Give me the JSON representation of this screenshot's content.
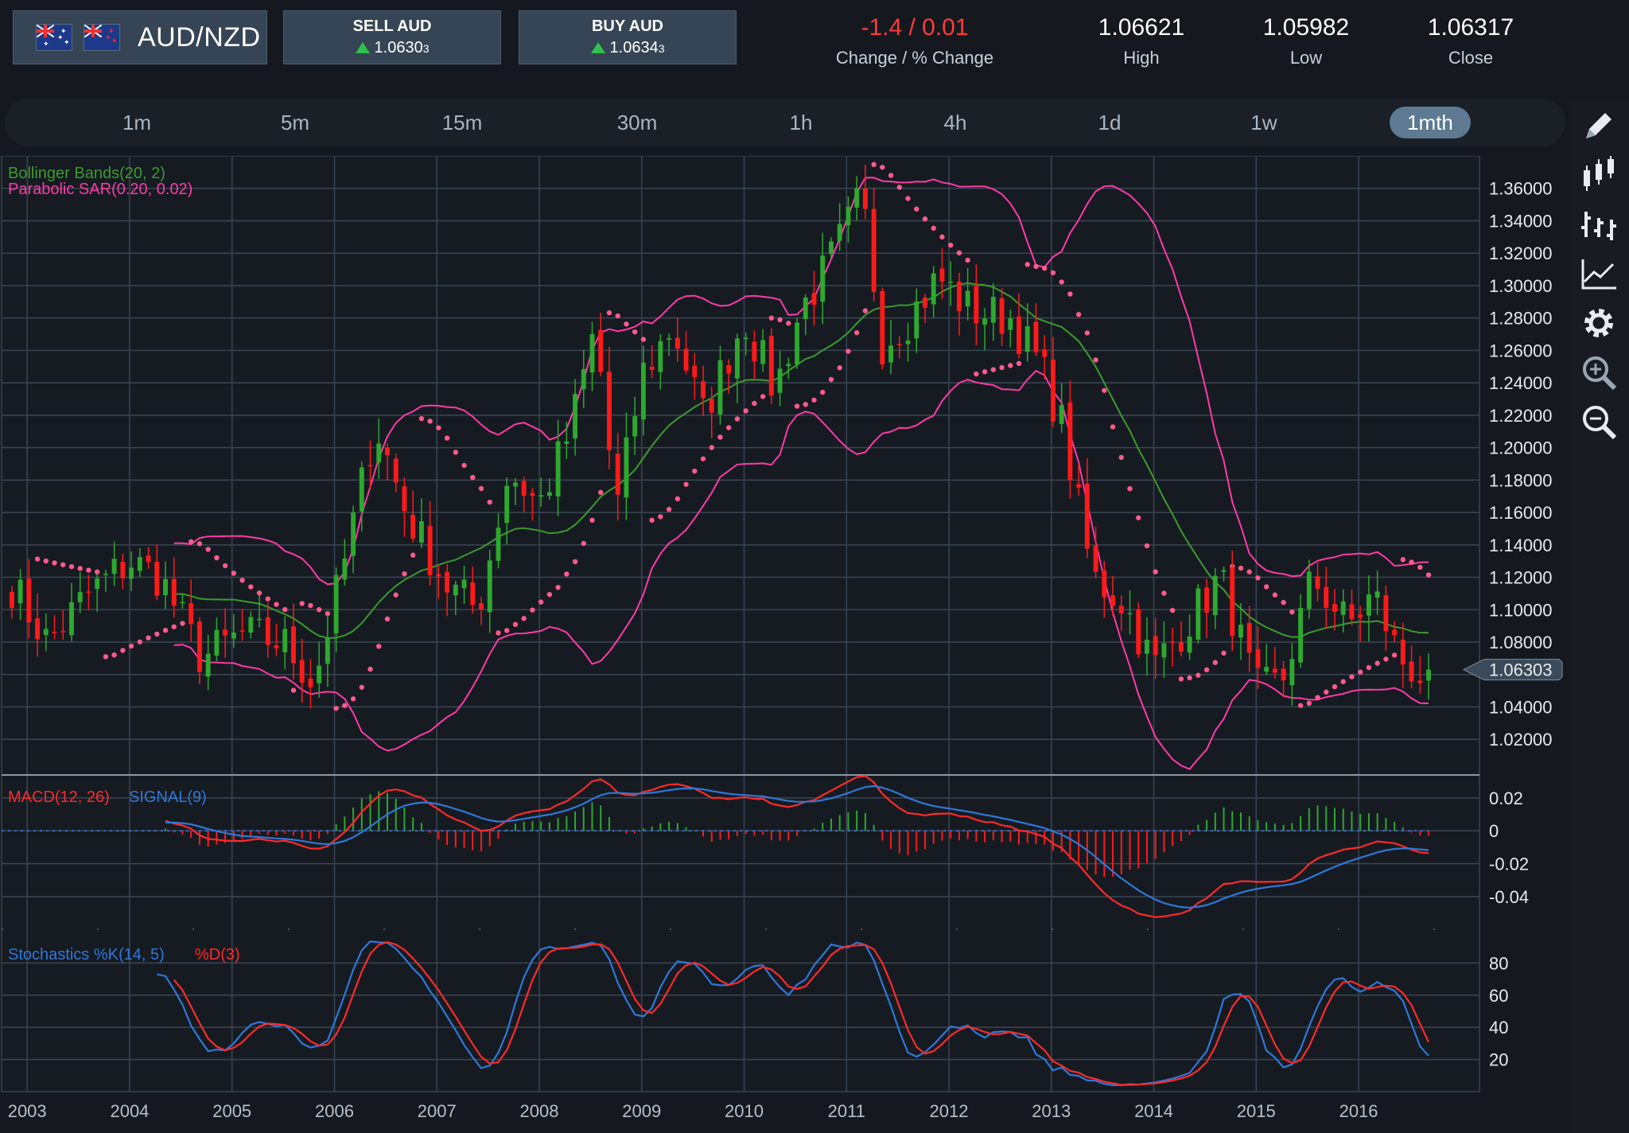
{
  "header": {
    "pair": "AUD/NZD",
    "sell": {
      "label": "SELL AUD",
      "price": "1.0630",
      "pip": "3"
    },
    "buy": {
      "label": "BUY AUD",
      "price": "1.0634",
      "pip": "3"
    },
    "change": {
      "value": "-1.4 / 0.01",
      "label": "Change / % Change"
    },
    "high": {
      "value": "1.06621",
      "label": "High"
    },
    "low": {
      "value": "1.05982",
      "label": "Low"
    },
    "close": {
      "value": "1.06317",
      "label": "Close"
    }
  },
  "timeframes": [
    "1m",
    "5m",
    "15m",
    "30m",
    "1h",
    "4h",
    "1d",
    "1w",
    "1mth"
  ],
  "active_timeframe": "1mth",
  "tools": [
    "pencil-icon",
    "candlestick-icon",
    "bar-chart-icon",
    "line-chart-icon",
    "gear-icon",
    "zoom-in-icon",
    "zoom-out-icon"
  ],
  "colors": {
    "bull": "#2ea82e",
    "bear": "#ff1a1a",
    "bollinger_mid": "#3c9a2e",
    "bollinger_bands": "#ff3aa8",
    "sar": "#ff5a8c",
    "macd": "#ff2a2a",
    "signal": "#2f78d8",
    "stoch_k": "#2f78d8",
    "stoch_d": "#ff2a2a"
  },
  "chart_data": {
    "type": "candlestick",
    "x_labels": [
      "2003",
      "2004",
      "2005",
      "2006",
      "2007",
      "2008",
      "2009",
      "2010",
      "2011",
      "2012",
      "2013",
      "2014",
      "2015",
      "2016"
    ],
    "price_axis": {
      "ticks": [
        "1.36000",
        "1.34000",
        "1.32000",
        "1.30000",
        "1.28000",
        "1.26000",
        "1.24000",
        "1.22000",
        "1.20000",
        "1.18000",
        "1.16000",
        "1.14000",
        "1.12000",
        "1.10000",
        "1.08000",
        "1.04000",
        "1.02000"
      ],
      "current": "1.06303",
      "current_value": 1.06303,
      "range": [
        0.999,
        1.38
      ]
    },
    "price_anchors": [
      [
        2002.85,
        1.115
      ],
      [
        2003.2,
        1.08
      ],
      [
        2003.6,
        1.11
      ],
      [
        2004.0,
        1.13
      ],
      [
        2004.3,
        1.12
      ],
      [
        2004.7,
        1.07
      ],
      [
        2005.1,
        1.085
      ],
      [
        2005.5,
        1.08
      ],
      [
        2005.8,
        1.055
      ],
      [
        2006.1,
        1.13
      ],
      [
        2006.4,
        1.215
      ],
      [
        2006.7,
        1.16
      ],
      [
        2007.1,
        1.115
      ],
      [
        2007.4,
        1.1
      ],
      [
        2007.7,
        1.185
      ],
      [
        2008.0,
        1.165
      ],
      [
        2008.3,
        1.21
      ],
      [
        2008.55,
        1.275
      ],
      [
        2008.75,
        1.16
      ],
      [
        2009.0,
        1.245
      ],
      [
        2009.3,
        1.275
      ],
      [
        2009.6,
        1.22
      ],
      [
        2010.0,
        1.28
      ],
      [
        2010.3,
        1.235
      ],
      [
        2010.55,
        1.285
      ],
      [
        2010.8,
        1.31
      ],
      [
        2011.15,
        1.355
      ],
      [
        2011.35,
        1.265
      ],
      [
        2011.6,
        1.28
      ],
      [
        2011.9,
        1.305
      ],
      [
        2012.2,
        1.285
      ],
      [
        2012.6,
        1.28
      ],
      [
        2012.9,
        1.25
      ],
      [
        2013.1,
        1.215
      ],
      [
        2013.4,
        1.12
      ],
      [
        2013.7,
        1.105
      ],
      [
        2014.0,
        1.065
      ],
      [
        2014.3,
        1.09
      ],
      [
        2014.65,
        1.12
      ],
      [
        2015.0,
        1.05
      ],
      [
        2015.25,
        1.055
      ],
      [
        2015.55,
        1.12
      ],
      [
        2015.9,
        1.09
      ],
      [
        2016.15,
        1.11
      ],
      [
        2016.4,
        1.07
      ],
      [
        2016.6,
        1.06
      ],
      [
        2016.75,
        1.063
      ]
    ],
    "indicators": [
      {
        "name": "Bollinger Bands(20, 2)"
      },
      {
        "name": "Parabolic SAR(0.20, 0.02)"
      }
    ],
    "macd": {
      "labels": [
        "MACD(12, 26)",
        "SIGNAL(9)"
      ],
      "ticks": [
        "0.02",
        "0",
        "-0.02",
        "-0.04"
      ],
      "range": [
        -0.058,
        0.033
      ]
    },
    "stochastics": {
      "labels": [
        "Stochastics %K(14, 5)",
        "%D(3)"
      ],
      "ticks": [
        "80",
        "60",
        "40",
        "20"
      ],
      "range": [
        0,
        100
      ]
    },
    "x_range": [
      2002.75,
      2017.18
    ]
  }
}
